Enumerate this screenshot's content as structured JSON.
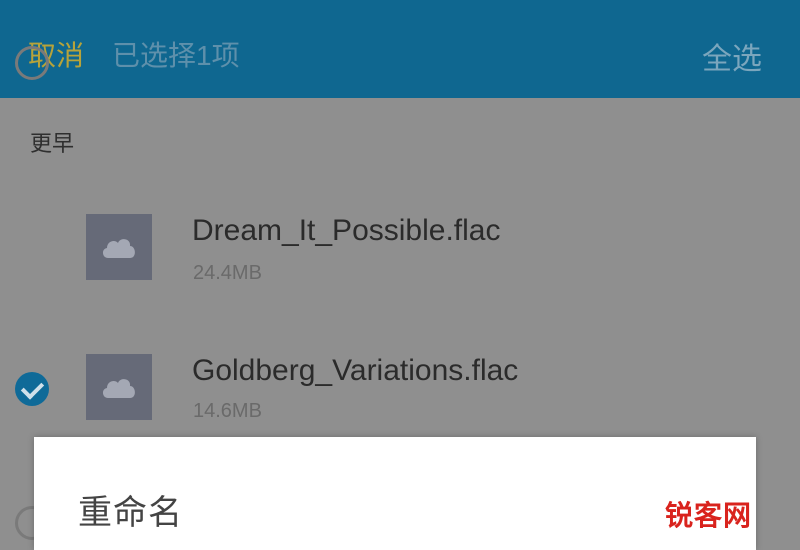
{
  "header": {
    "cancel_label": "取消",
    "selected_text": "已选择1项",
    "select_all_label": "全选"
  },
  "section": {
    "label": "更早"
  },
  "files": [
    {
      "name": "Dream_It_Possible.flac",
      "size": "24.4MB",
      "checked": false,
      "icon": "cloud-icon"
    },
    {
      "name": "Goldberg_Variations.flac",
      "size": "14.6MB",
      "checked": true,
      "icon": "cloud-icon"
    }
  ],
  "dialog": {
    "title": "重命名"
  },
  "watermark": "锐客网",
  "colors": {
    "header_bg": "#0f6790",
    "accent_check": "#0f6a98",
    "dim_overlay": "#8f8f8f"
  }
}
